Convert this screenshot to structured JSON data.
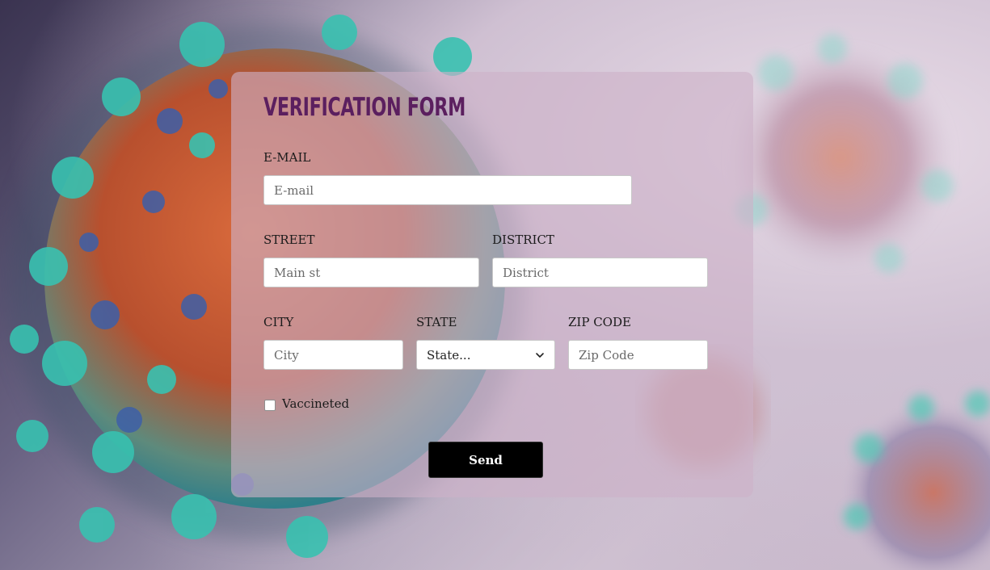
{
  "form": {
    "title": "VERIFICATION FORM",
    "email": {
      "label": "E-MAIL",
      "placeholder": "E-mail"
    },
    "street": {
      "label": "STREET",
      "placeholder": "Main st"
    },
    "district": {
      "label": "DISTRICT",
      "placeholder": "District"
    },
    "city": {
      "label": "CITY",
      "placeholder": "City"
    },
    "state": {
      "label": "STATE",
      "selected": "State..."
    },
    "zip": {
      "label": "ZIP CODE",
      "placeholder": "Zip Code"
    },
    "vaccinated": {
      "label": "Vaccineted",
      "checked": false
    },
    "submit_label": "Send"
  },
  "colors": {
    "title": "#5b1f5f",
    "card": "#cdb2c8",
    "button": "#000000",
    "button_text": "#ffffff"
  },
  "icons": {
    "state_dropdown": "chevron-down-icon"
  }
}
